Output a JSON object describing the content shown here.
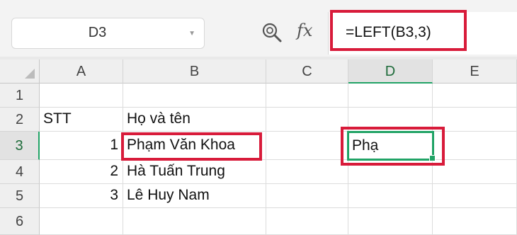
{
  "name_box": {
    "value": "D3"
  },
  "toolbar": {
    "fx_label": "fx"
  },
  "formula_bar": {
    "value": "=LEFT(B3,3)"
  },
  "columns": [
    "A",
    "B",
    "C",
    "D",
    "E"
  ],
  "rows": [
    "1",
    "2",
    "3",
    "4",
    "5",
    "6"
  ],
  "active_cell": "D3",
  "cells": {
    "A2": "STT",
    "B2": "Họ và tên",
    "A3": "1",
    "B3": "Phạm Văn Khoa",
    "D3": "Phạ",
    "A4": "2",
    "B4": "Hà Tuấn Trung",
    "A5": "3",
    "B5": "Lê Huy Nam"
  },
  "colors": {
    "highlight": "#d81b3a",
    "selection": "#21a366"
  }
}
